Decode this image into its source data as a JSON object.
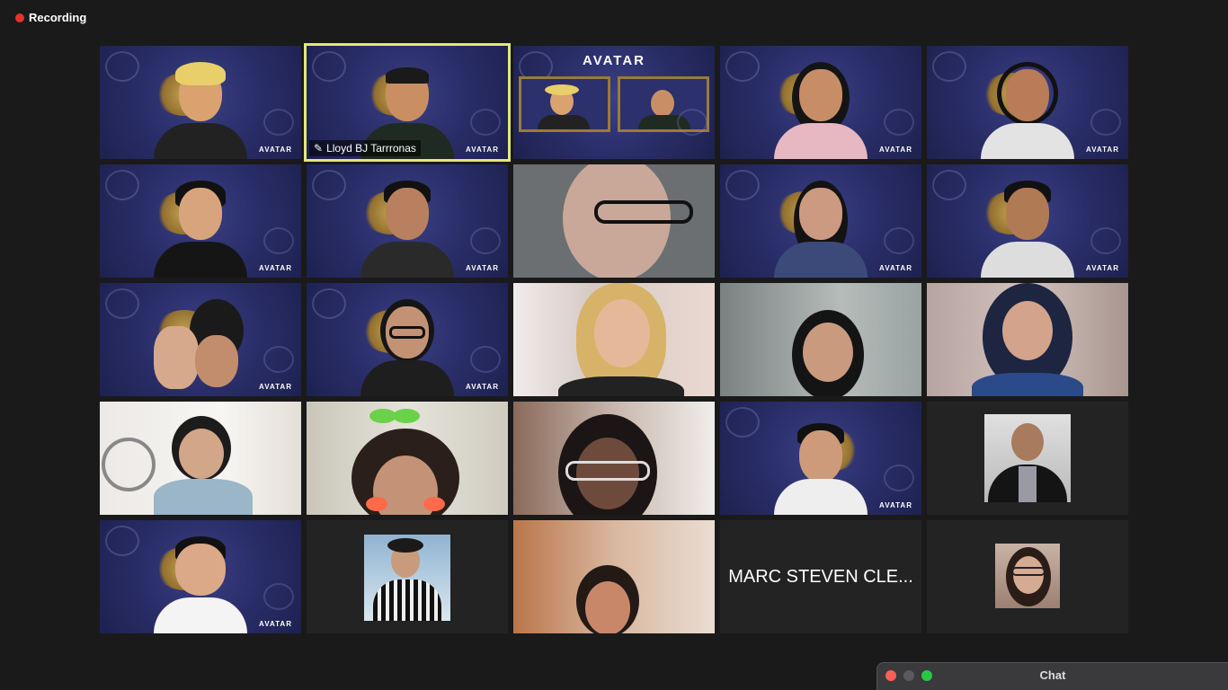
{
  "recording": {
    "label": "Recording"
  },
  "meeting": {
    "active_speaker": "Lloyd BJ Tarrronas",
    "banner_text": "AVATAR",
    "avatar_tag": "AVATAR",
    "name_only_tile": "MARC STEVEN CLE..."
  },
  "chat": {
    "title": "Chat"
  },
  "colors": {
    "active_outline": "#e3e878",
    "recording_dot": "#e5332a"
  },
  "icons": [
    "microphone-muted-icon",
    "pin-icon"
  ]
}
